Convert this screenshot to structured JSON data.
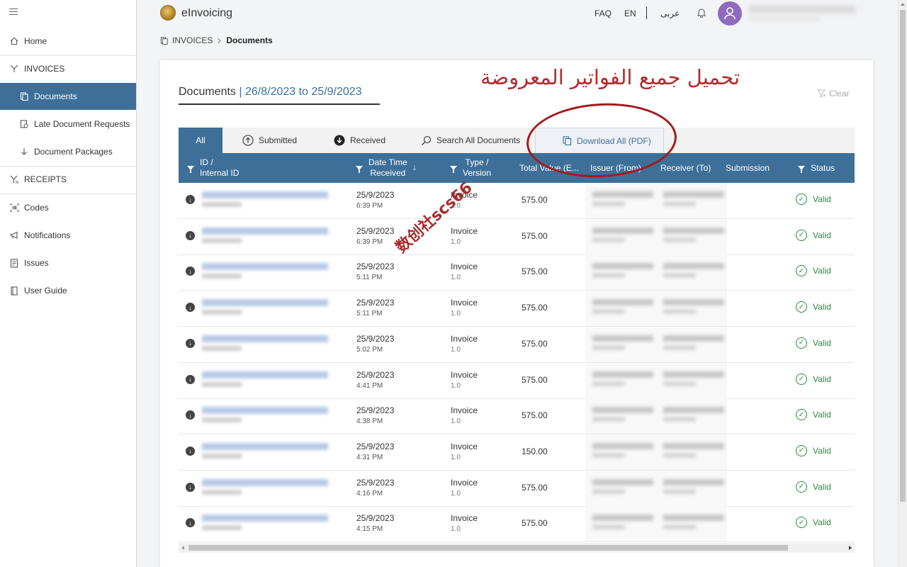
{
  "app": {
    "title": "eInvoicing"
  },
  "header": {
    "faq": "FAQ",
    "lang_en": "EN",
    "lang_ar": "عربى"
  },
  "sidebar": {
    "items": [
      {
        "label": "Home",
        "icon": "home-icon"
      },
      {
        "label": "INVOICES",
        "icon": "invoices-icon"
      },
      {
        "label": "Documents",
        "icon": "documents-icon",
        "active": true
      },
      {
        "label": "Late Document Requests",
        "icon": "late-requests-icon"
      },
      {
        "label": "Document Packages",
        "icon": "download-arrow-icon"
      },
      {
        "label": "RECEIPTS",
        "icon": "receipts-icon"
      },
      {
        "label": "Codes",
        "icon": "barcode-icon"
      },
      {
        "label": "Notifications",
        "icon": "megaphone-icon"
      },
      {
        "label": "Issues",
        "icon": "issues-icon"
      },
      {
        "label": "User Guide",
        "icon": "book-icon"
      }
    ]
  },
  "breadcrumb": {
    "parent": "INVOICES",
    "current": "Documents"
  },
  "page": {
    "title": "Documents",
    "range": "| 26/8/2023 to 25/9/2023",
    "clear": "Clear",
    "annotation": "تحميل جميع الفواتير المعروضة",
    "watermark": "数创社scs66"
  },
  "tabs": [
    {
      "label": "All",
      "active": true
    },
    {
      "label": "Submitted",
      "icon": "upload-circle-icon"
    },
    {
      "label": "Received",
      "icon": "download-circle-icon"
    },
    {
      "label": "Search All Documents",
      "icon": "search-icon"
    },
    {
      "label": "Download All (PDF)",
      "icon": "copy-icon"
    }
  ],
  "table": {
    "columns": {
      "id": "ID /",
      "id2": "Internal ID",
      "date": "Date Time",
      "date2": "Received",
      "type": "Type /",
      "type2": "Version",
      "total": "Total Value (E...",
      "issuer": "Issuer (From)",
      "receiver": "Receiver (To)",
      "submission": "Submission",
      "status": "Status"
    },
    "rows": [
      {
        "date": "25/9/2023",
        "time": "6:39 PM",
        "type": "Invoice",
        "version": "1.0",
        "total": "575.00",
        "status": "Valid"
      },
      {
        "date": "25/9/2023",
        "time": "6:39 PM",
        "type": "Invoice",
        "version": "1.0",
        "total": "575.00",
        "status": "Valid"
      },
      {
        "date": "25/9/2023",
        "time": "5:11 PM",
        "type": "Invoice",
        "version": "1.0",
        "total": "575.00",
        "status": "Valid"
      },
      {
        "date": "25/9/2023",
        "time": "5:11 PM",
        "type": "Invoice",
        "version": "1.0",
        "total": "575.00",
        "status": "Valid"
      },
      {
        "date": "25/9/2023",
        "time": "5:02 PM",
        "type": "Invoice",
        "version": "1.0",
        "total": "575.00",
        "status": "Valid"
      },
      {
        "date": "25/9/2023",
        "time": "4:41 PM",
        "type": "Invoice",
        "version": "1.0",
        "total": "575.00",
        "status": "Valid"
      },
      {
        "date": "25/9/2023",
        "time": "4:38 PM",
        "type": "Invoice",
        "version": "1.0",
        "total": "575.00",
        "status": "Valid"
      },
      {
        "date": "25/9/2023",
        "time": "4:31 PM",
        "type": "Invoice",
        "version": "1.0",
        "total": "150.00",
        "status": "Valid"
      },
      {
        "date": "25/9/2023",
        "time": "4:16 PM",
        "type": "Invoice",
        "version": "1.0",
        "total": "575.00",
        "status": "Valid"
      },
      {
        "date": "25/9/2023",
        "time": "4:15 PM",
        "type": "Invoice",
        "version": "1.0",
        "total": "575.00",
        "status": "Valid"
      }
    ]
  },
  "colors": {
    "primary": "#3d6f99",
    "valid": "#2e8b3d",
    "annotation": "#b52a2a"
  }
}
